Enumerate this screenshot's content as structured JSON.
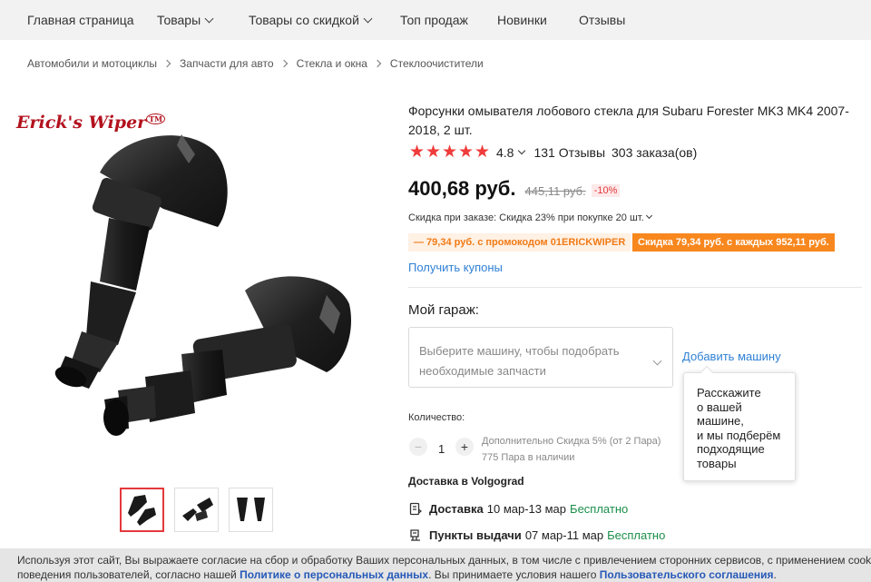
{
  "nav": {
    "items": [
      {
        "label": "Главная страница",
        "has_dropdown": false
      },
      {
        "label": "Товары",
        "has_dropdown": true
      },
      {
        "label": "Товары со скидкой",
        "has_dropdown": true
      },
      {
        "label": "Топ продаж",
        "has_dropdown": false
      },
      {
        "label": "Новинки",
        "has_dropdown": false
      },
      {
        "label": "Отзывы",
        "has_dropdown": false
      }
    ]
  },
  "breadcrumb": [
    "Автомобили и мотоциклы",
    "Запчасти для авто",
    "Стекла и окна",
    "Стеклоочистители"
  ],
  "gallery": {
    "brand_logo": "Erick's Wiper",
    "brand_tm": "TM",
    "thumbnails": [
      {
        "active": true
      },
      {
        "active": false
      },
      {
        "active": false
      }
    ]
  },
  "product": {
    "title": "Форсунки омывателя лобового стекла для Subaru Forester MK3 MK4 2007-2018, 2 шт.",
    "rating_value": "4.8",
    "rating_stars": 5,
    "reviews": "131 Отзывы",
    "orders": "303 заказа(ов)",
    "price": "400,68 руб.",
    "old_price": "445,11 руб.",
    "discount_pct": "-10%",
    "bulk_discount": "Скидка при заказе: Скидка 23% при покупке 20 шт.",
    "promo_code_tag": "— 79,34 руб. с промокодом 01ERICKWIPER",
    "promo_discount_tag": "Скидка 79,34 руб. с каждых 952,11 руб.",
    "coupons_link": "Получить купоны"
  },
  "garage": {
    "label": "Мой гараж:",
    "select_placeholder": "Выберите машину, чтобы подобрать необходимые запчасти",
    "add_car": "Добавить машину",
    "tooltip_lines": [
      "Расскажите",
      "о вашей",
      "машине,",
      "и мы подберём",
      "подходящие",
      "товары"
    ]
  },
  "quantity": {
    "label": "Количество:",
    "minus": "−",
    "value": "1",
    "plus": "+",
    "note_line1": "Дополнительно Скидка 5% (от 2 Пара)",
    "note_line2": "775 Пара в наличии"
  },
  "delivery": {
    "heading": "Доставка в Volgograd",
    "rows": [
      {
        "icon": "shipping-box-icon",
        "type": "Доставка",
        "dates": "10 мар-13 мар",
        "cost": "Бесплатно"
      },
      {
        "icon": "pickup-point-icon",
        "type": "Пункты выдачи",
        "dates": "07 мар-11 мар",
        "cost": "Бесплатно"
      }
    ]
  },
  "cookie": {
    "line1": "Используя этот сайт, Вы выражаете согласие на сбор и обработку Ваших персональных данных, в том числе с привлечением сторонних сервисов, с применением cookie-файлов",
    "line2_prefix": "поведения пользователей, согласно нашей ",
    "privacy_link": "Политике о персональных данных",
    "line2_mid": ". Вы принимаете условия нашего ",
    "terms_link": "Пользовательского соглашения",
    "line2_suffix": "."
  },
  "colors": {
    "accent_red": "#e4393c",
    "star": "#ef3b3b",
    "link_blue": "#2f81d5",
    "promo_orange": "#f8871e",
    "free_green": "#1a8f4a",
    "brand_red": "#b3121e"
  }
}
